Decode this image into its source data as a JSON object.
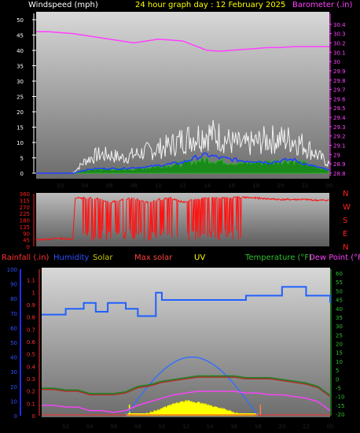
{
  "colors": {
    "windspeed": "#ffffff",
    "windavg": "#2040ff",
    "windgust_fill": "#1a8a1a",
    "barometer": "#ff40ff",
    "title": "#ffff00",
    "direction": "#ff2020",
    "rainfall": "#ff3030",
    "humidity": "#3050ff",
    "solar": "#c8c800",
    "maxsolar": "#ff4040",
    "uv": "#ffff00",
    "temperature": "#30c030",
    "dewpoint": "#ff40ff",
    "bg_light": "#d0d0d0",
    "bg_dark": "#606060"
  },
  "chart_data": [
    {
      "type": "line",
      "title": "24 hour graph day : 12 February 2025",
      "ylabel_left": "Windspeed (mph)",
      "ylabel_right": "Barometer (.in)",
      "ylim_left": [
        0,
        50
      ],
      "ylim_right": [
        28.8,
        30.5
      ],
      "left_ticks": [
        "0",
        "5",
        "10",
        "15",
        "20",
        "25",
        "30",
        "35",
        "40",
        "45",
        "50"
      ],
      "right_ticks": [
        "28.8",
        "28.9",
        "29",
        "29.1",
        "29.2",
        "29.3",
        "29.4",
        "29.5",
        "29.6",
        "29.7",
        "29.8",
        "29.9",
        "30",
        "30.1",
        "30.2",
        "30.3",
        "30.4"
      ],
      "x_ticks": [
        "00",
        "02",
        "04",
        "06",
        "08",
        "10",
        "12",
        "14",
        "16",
        "18",
        "20",
        "22",
        "00"
      ],
      "series": [
        {
          "name": "Barometer",
          "axis": "right",
          "x": [
            0,
            1,
            2,
            3,
            4,
            5,
            6,
            7,
            8,
            9,
            10,
            11,
            12,
            13,
            14,
            15,
            16,
            17,
            18,
            19,
            20,
            21,
            22,
            23,
            24
          ],
          "values": [
            30.32,
            30.32,
            30.31,
            30.3,
            30.28,
            30.26,
            30.24,
            30.22,
            30.2,
            30.22,
            30.24,
            30.23,
            30.22,
            30.17,
            30.12,
            30.11,
            30.12,
            30.13,
            30.14,
            30.15,
            30.15,
            30.16,
            30.16,
            30.16,
            30.16
          ]
        },
        {
          "name": "Windspeed",
          "axis": "left",
          "x": [
            0,
            1,
            2,
            3,
            4,
            5,
            6,
            7,
            8,
            9,
            10,
            11,
            12,
            13,
            14,
            15,
            16,
            17,
            18,
            19,
            20,
            21,
            22,
            23,
            24
          ],
          "values": [
            0,
            0,
            0,
            0,
            2,
            3,
            3,
            3,
            3,
            4,
            5,
            6,
            7,
            9,
            10,
            9,
            8,
            7,
            8,
            8,
            9,
            9,
            7,
            4,
            2
          ]
        },
        {
          "name": "Wind average",
          "axis": "left",
          "x": [
            0,
            1,
            2,
            3,
            4,
            5,
            6,
            7,
            8,
            9,
            10,
            11,
            12,
            13,
            14,
            15,
            16,
            17,
            18,
            19,
            20,
            21,
            22,
            23,
            24
          ],
          "values": [
            0,
            0,
            0,
            0,
            1,
            1.5,
            1.5,
            1.5,
            1.8,
            2,
            2.5,
            3,
            3.5,
            5,
            6,
            5,
            4.5,
            4,
            4,
            3.5,
            4,
            4.5,
            3,
            2,
            1
          ]
        },
        {
          "name": "Wind gust max",
          "axis": "left",
          "x": [
            0,
            1,
            2,
            3,
            4,
            5,
            6,
            7,
            8,
            9,
            10,
            11,
            12,
            13,
            14,
            15,
            16,
            17,
            18,
            19,
            20,
            21,
            22,
            23,
            24
          ],
          "values": [
            0,
            0,
            0,
            0,
            4,
            6,
            6,
            5,
            6,
            7,
            8,
            9,
            11,
            12,
            13,
            12,
            10,
            9,
            10,
            11,
            11,
            11,
            9,
            6,
            3
          ]
        }
      ]
    },
    {
      "type": "scatter",
      "ylim": [
        0,
        360
      ],
      "left_ticks": [
        "0",
        "45",
        "90",
        "135",
        "180",
        "225",
        "270",
        "315",
        "360"
      ],
      "right_labels": [
        "N",
        "W",
        "S",
        "E",
        "N"
      ],
      "series": [
        {
          "name": "Wind direction",
          "x": [
            0,
            1,
            2,
            3,
            3.2,
            3.5,
            4,
            5,
            6,
            7,
            8,
            9,
            10,
            11,
            12,
            13,
            14,
            15,
            16,
            17,
            18,
            19,
            20,
            21,
            22,
            23,
            24
          ],
          "values": [
            45,
            50,
            55,
            50,
            330,
            330,
            330,
            330,
            300,
            320,
            330,
            300,
            320,
            330,
            300,
            320,
            330,
            330,
            335,
            335,
            330,
            325,
            320,
            320,
            320,
            315,
            315
          ]
        }
      ]
    },
    {
      "type": "line",
      "legend": [
        "Rainfall (.in)",
        "Humidity",
        "Solar",
        "Max solar",
        "UV",
        "Temperature (°F)",
        "Dew Point (°F)"
      ],
      "ylim_left": [
        0,
        100
      ],
      "ylim_rain": [
        0,
        1.2
      ],
      "ylim_temp": [
        -20,
        60
      ],
      "left_ticks": [
        "0",
        "10",
        "20",
        "30",
        "40",
        "50",
        "60",
        "70",
        "80",
        "90",
        "100"
      ],
      "rain_ticks": [
        "0",
        "0.1",
        "0.2",
        "0.3",
        "0.4",
        "0.5",
        "0.6",
        "0.7",
        "0.8",
        "0.9",
        "1",
        "1.1"
      ],
      "temp_ticks": [
        "-20",
        "-15",
        "-10",
        "-5",
        "0",
        "5",
        "10",
        "15",
        "20",
        "25",
        "30",
        "35",
        "40",
        "45",
        "50",
        "55",
        "60"
      ],
      "x_ticks": [
        "02",
        "04",
        "06",
        "08",
        "10",
        "12",
        "14",
        "16",
        "18",
        "20",
        "22",
        "00"
      ],
      "series": [
        {
          "name": "Humidity",
          "axis": "left",
          "x": [
            0,
            1,
            2,
            3,
            3.5,
            4,
            4.5,
            5,
            5.5,
            6,
            7,
            8,
            9,
            9.5,
            10,
            11,
            12,
            13,
            14,
            15,
            16,
            17,
            18,
            19,
            20,
            21,
            22,
            23,
            24
          ],
          "values": [
            69,
            69,
            73,
            73,
            77,
            77,
            71,
            71,
            77,
            77,
            73,
            68,
            68,
            84,
            79,
            79,
            79,
            79,
            79,
            79,
            79,
            82,
            82,
            82,
            88,
            88,
            82,
            82,
            77
          ]
        },
        {
          "name": "Temperature (°F)",
          "axis": "temp",
          "x": [
            0,
            1,
            2,
            3,
            4,
            5,
            6,
            7,
            8,
            9,
            10,
            11,
            12,
            13,
            14,
            15,
            16,
            17,
            18,
            19,
            20,
            21,
            22,
            23,
            24
          ],
          "values": [
            -6,
            -6,
            -7,
            -7,
            -9,
            -9,
            -9,
            -8,
            -5,
            -4,
            -2,
            -1,
            0,
            1,
            1,
            1,
            1,
            0,
            0,
            0,
            -1,
            -2,
            -3,
            -5,
            -10
          ]
        },
        {
          "name": "Dew Point (°F)",
          "axis": "temp",
          "x": [
            0,
            1,
            2,
            3,
            4,
            5,
            6,
            7,
            8,
            9,
            10,
            11,
            12,
            13,
            14,
            15,
            16,
            17,
            18,
            19,
            20,
            21,
            22,
            23,
            24
          ],
          "values": [
            -8,
            -8,
            -9,
            -9,
            -11,
            -11,
            -12,
            -11,
            -8,
            -6,
            -4,
            -2,
            -1,
            0,
            0,
            0,
            0,
            -1,
            -1,
            -2,
            -2,
            -3,
            -4,
            -6,
            -11
          ]
        },
        {
          "name": "Max solar",
          "axis": "left",
          "x": [
            7,
            8,
            9,
            10,
            11,
            12,
            13,
            14,
            15,
            16,
            17,
            18
          ],
          "values": [
            0,
            8,
            18,
            26,
            31,
            34,
            34,
            31,
            26,
            18,
            8,
            0
          ]
        },
        {
          "name": "Solar",
          "axis": "left",
          "x": [
            7,
            8,
            9,
            10,
            11,
            12,
            13,
            14,
            15,
            16,
            17,
            18
          ],
          "values": [
            0,
            0.5,
            2,
            5,
            8,
            10,
            9,
            7,
            5,
            2,
            0.5,
            0
          ]
        },
        {
          "name": "UV",
          "axis": "left",
          "x": [
            7,
            8,
            9,
            10,
            11,
            12,
            13,
            14,
            15,
            16,
            17,
            18
          ],
          "values": [
            0,
            0,
            0,
            1,
            1,
            1,
            1,
            1,
            1,
            0,
            0,
            0
          ]
        },
        {
          "name": "Rainfall (.in)",
          "axis": "rain",
          "x": [
            0,
            24
          ],
          "values": [
            0,
            0
          ]
        }
      ]
    }
  ]
}
